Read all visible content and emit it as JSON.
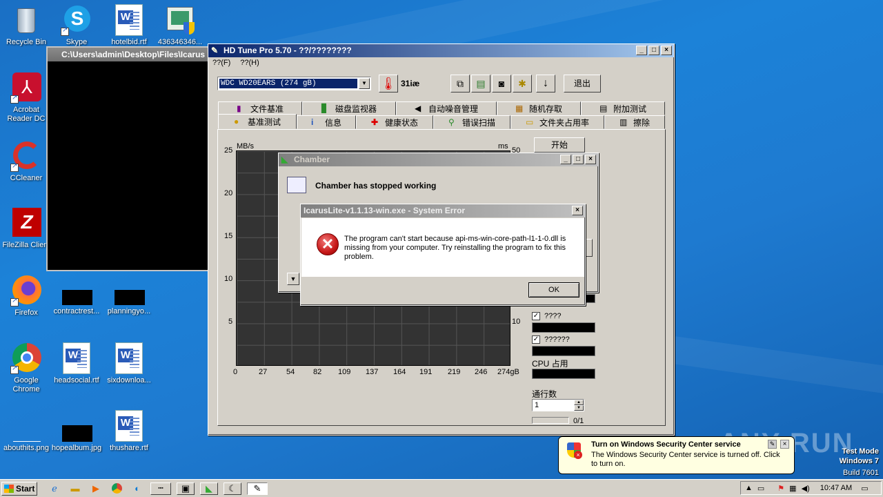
{
  "desktop": {
    "icons": [
      {
        "label": "Recycle Bin"
      },
      {
        "label": "Skype"
      },
      {
        "label": "hotelbid.rtf"
      },
      {
        "label": "436346346..."
      },
      {
        "label": "Acrobat Reader DC"
      },
      {
        "label": "CCleaner"
      },
      {
        "label": "FileZilla Client"
      },
      {
        "label": "Firefox"
      },
      {
        "label": "contractrest..."
      },
      {
        "label": "planningyo..."
      },
      {
        "label": "Google Chrome"
      },
      {
        "label": "headsocial.rtf"
      },
      {
        "label": "sixdownloa..."
      },
      {
        "label": "abouthits.png"
      },
      {
        "label": "hopealbum.jpg"
      },
      {
        "label": "thushare.rtf"
      }
    ]
  },
  "console": {
    "title": "C:\\Users\\admin\\Desktop\\Files\\Icarus"
  },
  "hdtune": {
    "title": "HD Tune Pro 5.70 - ??/????????",
    "menu": [
      "??(F)",
      "??(H)"
    ],
    "drive": "WDC WD20EARS (274 gB)",
    "temperature": "31iæ",
    "exit_label": "退出",
    "tabs_top": [
      "文件基准",
      "磁盘监视器",
      "自动噪音管理",
      "随机存取",
      "附加测试"
    ],
    "tabs_bottom": [
      "基准测试",
      "信息",
      "健康状态",
      "错误扫描",
      "文件夹占用率",
      "擦除"
    ],
    "start_label": "开始",
    "y_left_unit": "MB/s",
    "y_right_unit": "ms",
    "y_left_ticks": [
      "25",
      "20",
      "15",
      "10",
      "5"
    ],
    "y_right_ticks": [
      "50",
      "10"
    ],
    "x_ticks": [
      "0",
      "27",
      "54",
      "82",
      "109",
      "137",
      "164",
      "191",
      "219",
      "246",
      "274gB"
    ],
    "check1": "????",
    "check2": "??????",
    "cpu_label": "CPU 占用",
    "passes_label": "通行数",
    "passes_value": "1",
    "progress": "0/1"
  },
  "chamber": {
    "title": "Chamber",
    "heading": "Chamber has stopped working"
  },
  "error": {
    "title": "IcarusLite-v1.1.13-win.exe - System Error",
    "message": "The program can't start because api-ms-win-core-path-l1-1-0.dll is missing from your computer. Try reinstalling the program to fix this problem.",
    "ok": "OK"
  },
  "balloon": {
    "title": "Turn on Windows Security Center service",
    "text": "The Windows Security Center service is turned off. Click to turn on."
  },
  "watermark": {
    "brand": "ANY RUN",
    "line1": "Test Mode",
    "line2": "Windows 7",
    "line3": "Build 7601"
  },
  "taskbar": {
    "start": "Start",
    "clock": "10:47 AM"
  }
}
